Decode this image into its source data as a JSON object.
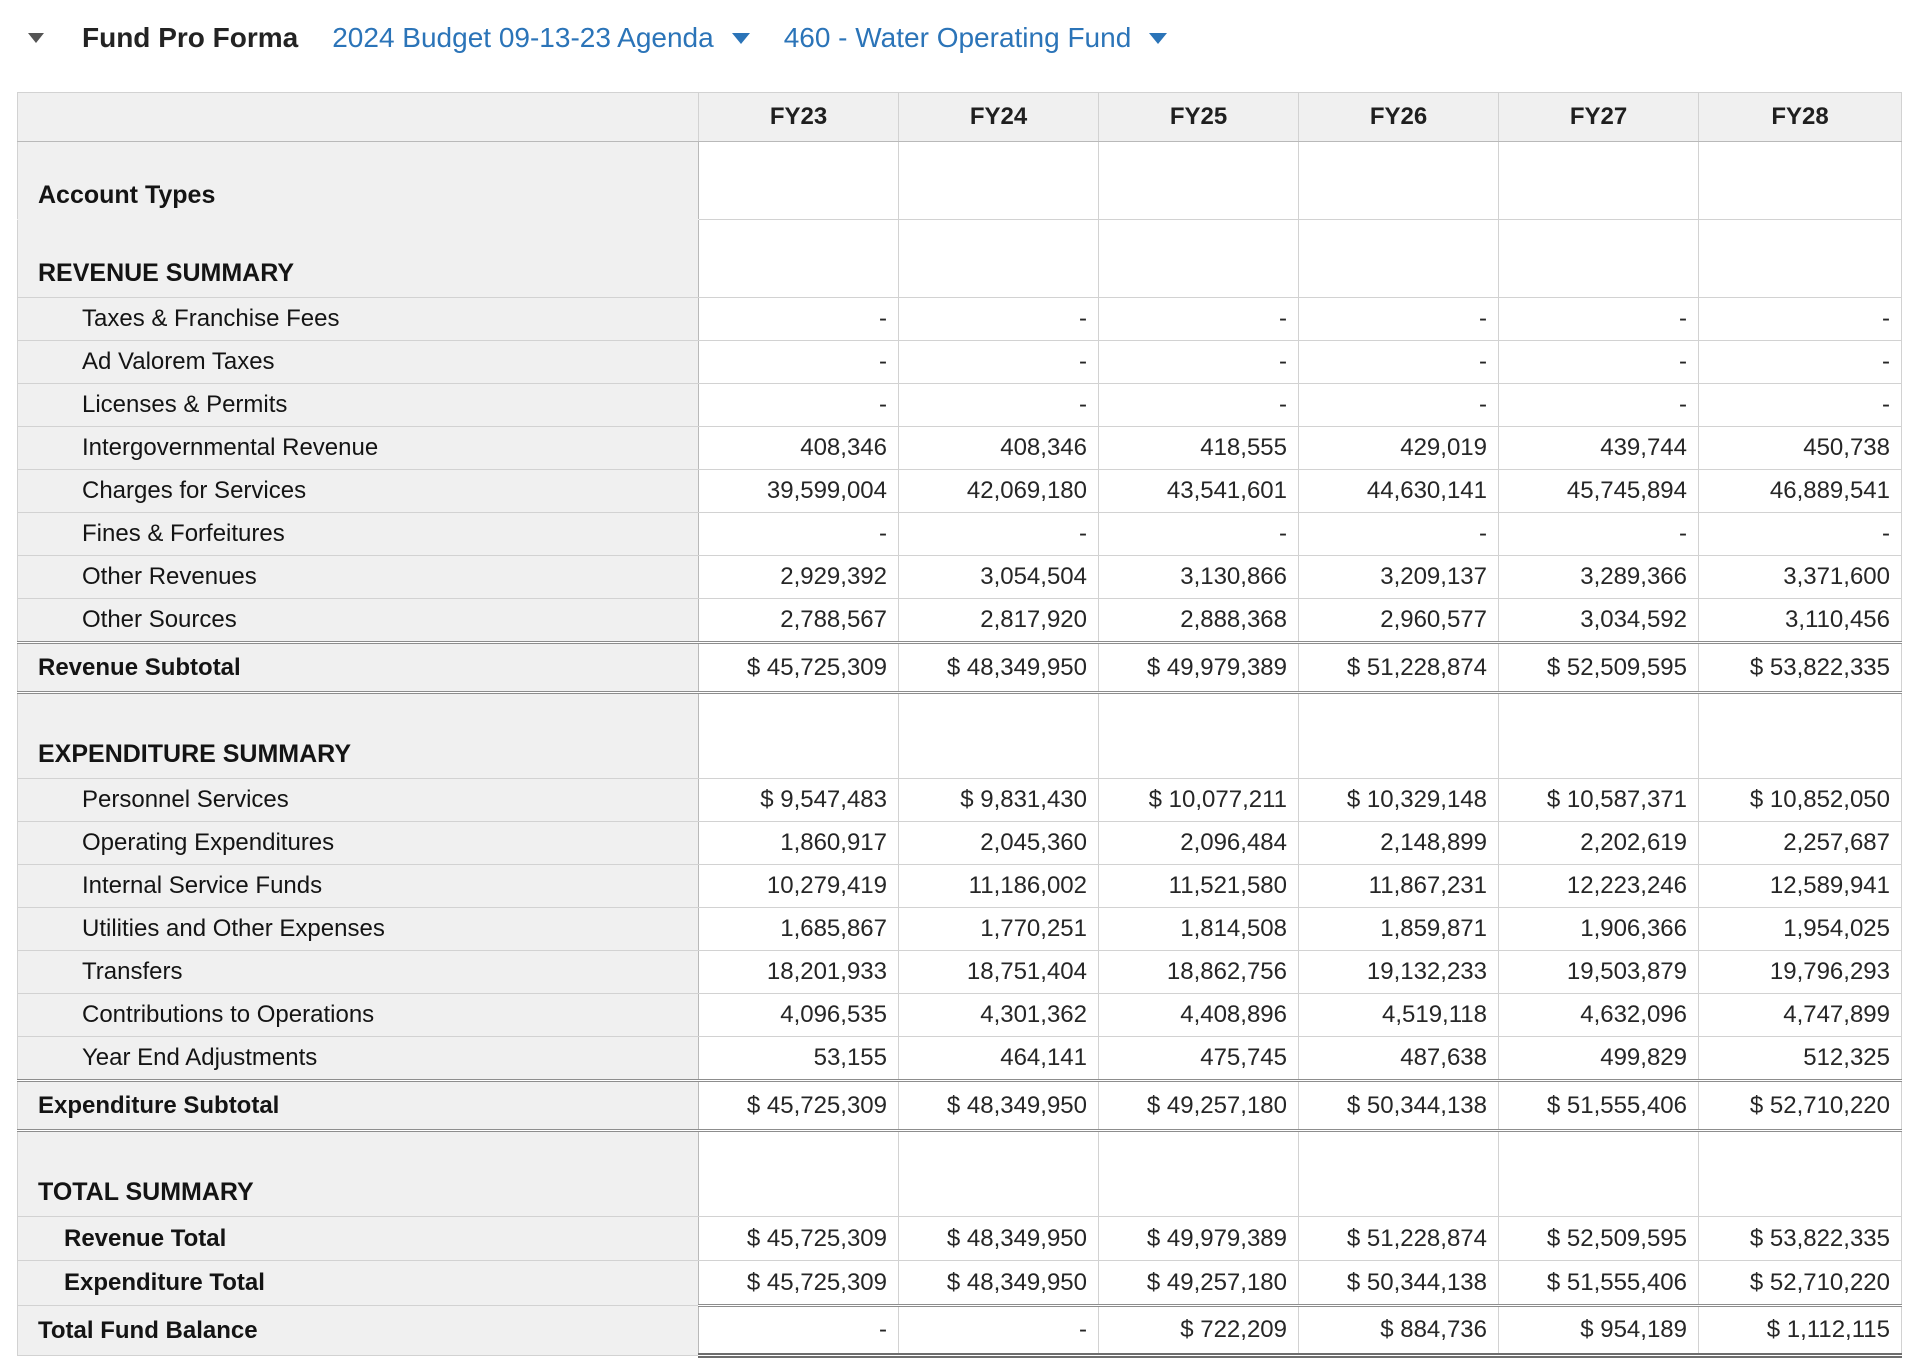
{
  "header": {
    "collapse_icon": "caret-down",
    "title": "Fund Pro Forma",
    "budget_selector": {
      "label": "2024 Budget 09-13-23 Agenda"
    },
    "fund_selector": {
      "label": "460 - Water Operating Fund"
    }
  },
  "colors": {
    "accent_blue": "#2b74b8",
    "panel_gray": "#f0f0f0",
    "double_line_gray": "#8d8d8d"
  },
  "table": {
    "columns": [
      "FY23",
      "FY24",
      "FY25",
      "FY26",
      "FY27",
      "FY28"
    ],
    "rows": [
      {
        "label": "Account Types",
        "style": "section",
        "values": [
          "",
          "",
          "",
          "",
          "",
          ""
        ]
      },
      {
        "label": "REVENUE SUMMARY",
        "style": "section",
        "values": [
          "",
          "",
          "",
          "",
          "",
          ""
        ]
      },
      {
        "label": "Taxes & Franchise Fees",
        "style": "item",
        "values": [
          "-",
          "-",
          "-",
          "-",
          "-",
          "-"
        ]
      },
      {
        "label": "Ad Valorem Taxes",
        "style": "item",
        "values": [
          "-",
          "-",
          "-",
          "-",
          "-",
          "-"
        ]
      },
      {
        "label": "Licenses & Permits",
        "style": "item",
        "values": [
          "-",
          "-",
          "-",
          "-",
          "-",
          "-"
        ]
      },
      {
        "label": "Intergovernmental Revenue",
        "style": "item",
        "values": [
          "408,346",
          "408,346",
          "418,555",
          "429,019",
          "439,744",
          "450,738"
        ]
      },
      {
        "label": "Charges for Services",
        "style": "item",
        "values": [
          "39,599,004",
          "42,069,180",
          "43,541,601",
          "44,630,141",
          "45,745,894",
          "46,889,541"
        ]
      },
      {
        "label": "Fines & Forfeitures",
        "style": "item",
        "values": [
          "-",
          "-",
          "-",
          "-",
          "-",
          "-"
        ]
      },
      {
        "label": "Other Revenues",
        "style": "item",
        "values": [
          "2,929,392",
          "3,054,504",
          "3,130,866",
          "3,209,137",
          "3,289,366",
          "3,371,600"
        ]
      },
      {
        "label": "Other Sources",
        "style": "item",
        "values": [
          "2,788,567",
          "2,817,920",
          "2,888,368",
          "2,960,577",
          "3,034,592",
          "3,110,456"
        ]
      },
      {
        "label": "Revenue Subtotal",
        "style": "subtotal",
        "values": [
          "$ 45,725,309",
          "$ 48,349,950",
          "$ 49,979,389",
          "$ 51,228,874",
          "$ 52,509,595",
          "$ 53,822,335"
        ]
      },
      {
        "label": "EXPENDITURE SUMMARY",
        "style": "xsection",
        "values": [
          "",
          "",
          "",
          "",
          "",
          ""
        ]
      },
      {
        "label": "Personnel Services",
        "style": "item",
        "values": [
          "$ 9,547,483",
          "$ 9,831,430",
          "$ 10,077,211",
          "$ 10,329,148",
          "$ 10,587,371",
          "$ 10,852,050"
        ]
      },
      {
        "label": "Operating Expenditures",
        "style": "item",
        "values": [
          "1,860,917",
          "2,045,360",
          "2,096,484",
          "2,148,899",
          "2,202,619",
          "2,257,687"
        ]
      },
      {
        "label": "Internal Service Funds",
        "style": "item",
        "values": [
          "10,279,419",
          "11,186,002",
          "11,521,580",
          "11,867,231",
          "12,223,246",
          "12,589,941"
        ]
      },
      {
        "label": "Utilities and Other Expenses",
        "style": "item",
        "values": [
          "1,685,867",
          "1,770,251",
          "1,814,508",
          "1,859,871",
          "1,906,366",
          "1,954,025"
        ]
      },
      {
        "label": "Transfers",
        "style": "item",
        "values": [
          "18,201,933",
          "18,751,404",
          "18,862,756",
          "19,132,233",
          "19,503,879",
          "19,796,293"
        ]
      },
      {
        "label": "Contributions to Operations",
        "style": "item",
        "values": [
          "4,096,535",
          "4,301,362",
          "4,408,896",
          "4,519,118",
          "4,632,096",
          "4,747,899"
        ]
      },
      {
        "label": "Year End Adjustments",
        "style": "item",
        "values": [
          "53,155",
          "464,141",
          "475,745",
          "487,638",
          "499,829",
          "512,325"
        ]
      },
      {
        "label": "Expenditure Subtotal",
        "style": "subtotal",
        "values": [
          "$ 45,725,309",
          "$ 48,349,950",
          "$ 49,257,180",
          "$ 50,344,138",
          "$ 51,555,406",
          "$ 52,710,220"
        ]
      },
      {
        "label": "TOTAL SUMMARY",
        "style": "xsection",
        "values": [
          "",
          "",
          "",
          "",
          "",
          ""
        ]
      },
      {
        "label": "Revenue Total",
        "style": "total",
        "values": [
          "$ 45,725,309",
          "$ 48,349,950",
          "$ 49,979,389",
          "$ 51,228,874",
          "$ 52,509,595",
          "$ 53,822,335"
        ]
      },
      {
        "label": "Expenditure Total",
        "style": "total_last",
        "values": [
          "$ 45,725,309",
          "$ 48,349,950",
          "$ 49,257,180",
          "$ 50,344,138",
          "$ 51,555,406",
          "$ 52,710,220"
        ]
      },
      {
        "label": "Total Fund Balance",
        "style": "grand",
        "values": [
          "-",
          "-",
          "$ 722,209",
          "$ 884,736",
          "$ 954,189",
          "$ 1,112,115"
        ]
      }
    ]
  }
}
